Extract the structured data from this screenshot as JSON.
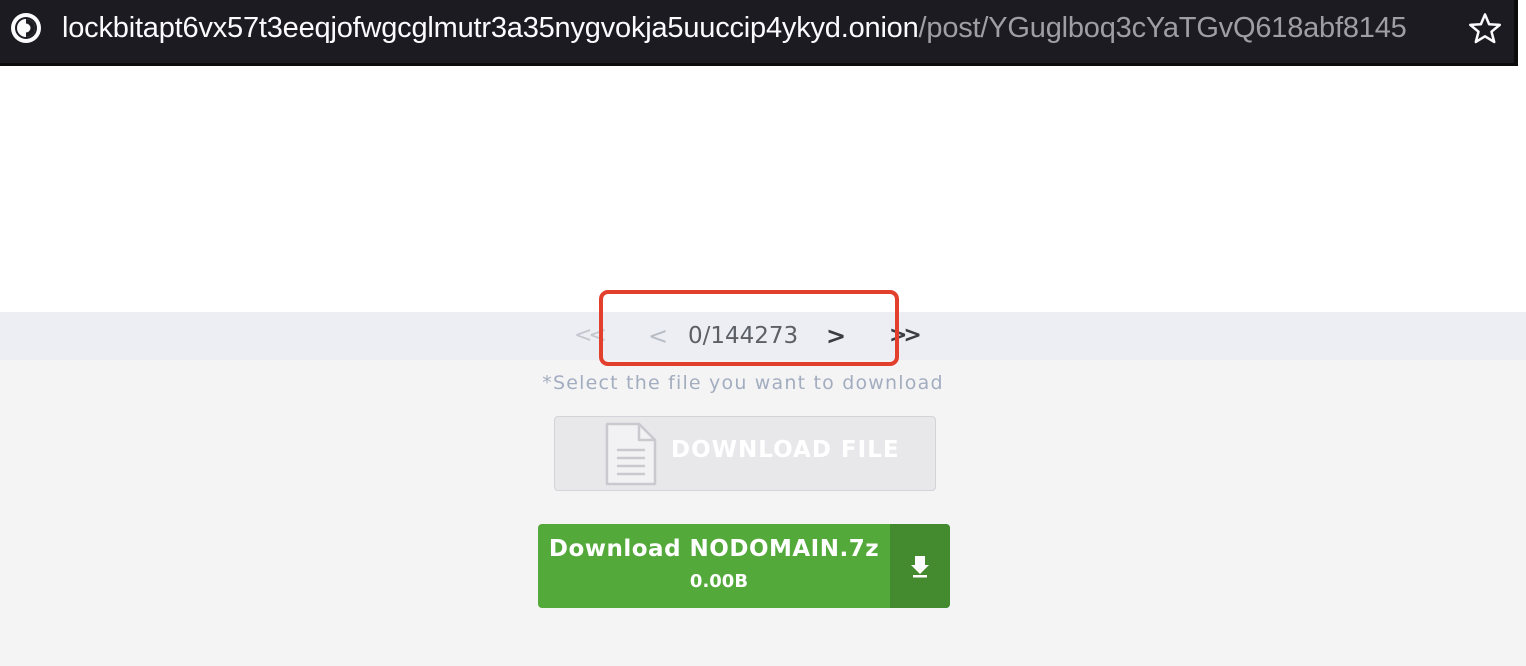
{
  "browser": {
    "url_host": "lockbitapt6vx57t3eeqjofwgcglmutr3a35nygvokja5uuccip4ykyd.onion",
    "url_path": "/post/YGuglboq3cYaTGvQ618abf8145",
    "tor_icon": "onion-icon",
    "bookmark_icon": "star-outline-icon"
  },
  "pager": {
    "first": "<<",
    "prev": "<",
    "count": "0/144273",
    "next": ">",
    "last": ">>"
  },
  "hint": "*Select the file you want to download",
  "download_file": {
    "label": "DOWNLOAD FILE",
    "icon": "document-icon"
  },
  "download_archive": {
    "title": "Download NODOMAIN.7z",
    "size": "0.00B",
    "icon": "download-arrow-icon"
  },
  "colors": {
    "highlight": "#e2402d",
    "download_green": "#53a93a",
    "download_green_dark": "#438b2e"
  }
}
